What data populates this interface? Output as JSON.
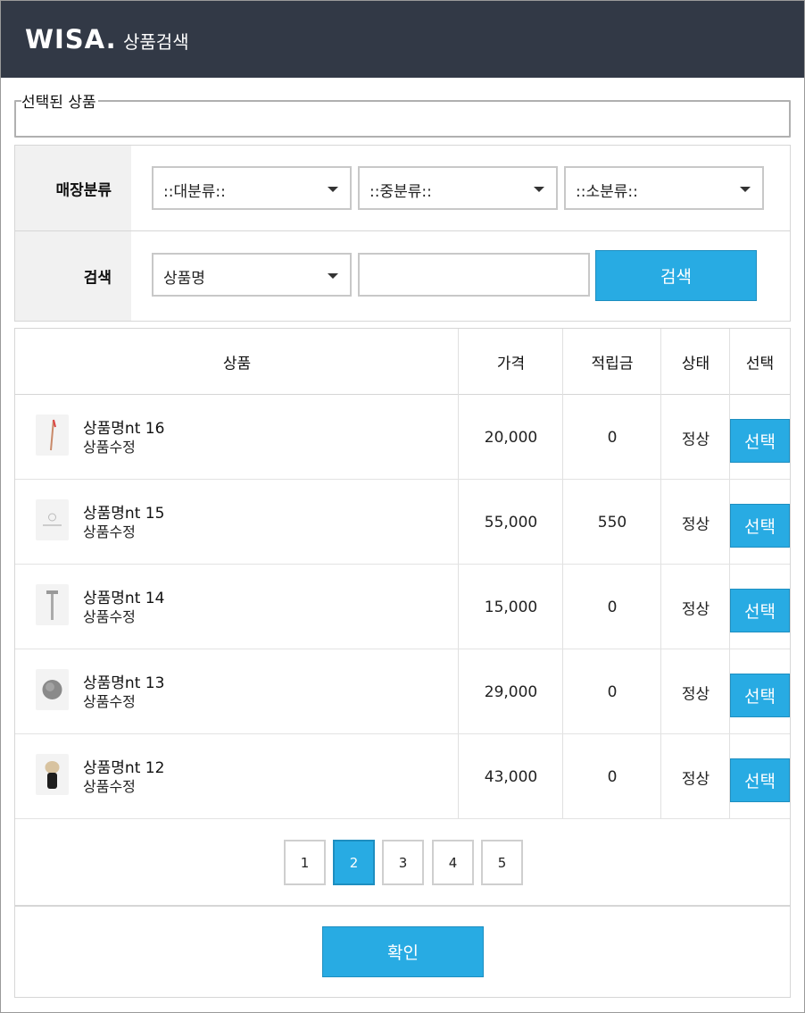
{
  "header": {
    "logo": "WISA.",
    "title": "상품검색"
  },
  "selected": {
    "legend": "선택된 상품"
  },
  "filter": {
    "category_label": "매장분류",
    "category_large": "::대분류::",
    "category_medium": "::중분류::",
    "category_small": "::소분류::",
    "search_label": "검색",
    "search_field": "상품명",
    "search_value": "",
    "search_button": "검색"
  },
  "table": {
    "headers": {
      "product": "상품",
      "price": "가격",
      "points": "적립금",
      "status": "상태",
      "select": "선택"
    },
    "rows": [
      {
        "name": "상품명nt 16",
        "edit": "상품수정",
        "price": "20,000",
        "points": "0",
        "status": "정상",
        "button": "선택",
        "thumb": "brush-thumbnail-icon"
      },
      {
        "name": "상품명nt 15",
        "edit": "상품수정",
        "price": "55,000",
        "points": "550",
        "status": "정상",
        "button": "선택",
        "thumb": "logo-thumbnail-icon"
      },
      {
        "name": "상품명nt 14",
        "edit": "상품수정",
        "price": "15,000",
        "points": "0",
        "status": "정상",
        "button": "선택",
        "thumb": "razor-thumbnail-icon"
      },
      {
        "name": "상품명nt 13",
        "edit": "상품수정",
        "price": "29,000",
        "points": "0",
        "status": "정상",
        "button": "선택",
        "thumb": "soap-thumbnail-icon"
      },
      {
        "name": "상품명nt 12",
        "edit": "상품수정",
        "price": "43,000",
        "points": "0",
        "status": "정상",
        "button": "선택",
        "thumb": "shaving-brush-thumbnail-icon"
      }
    ]
  },
  "pagination": {
    "pages": [
      "1",
      "2",
      "3",
      "4",
      "5"
    ],
    "current": "2"
  },
  "footer": {
    "confirm": "확인"
  },
  "colors": {
    "header_bg": "#323946",
    "accent": "#28abe3"
  }
}
